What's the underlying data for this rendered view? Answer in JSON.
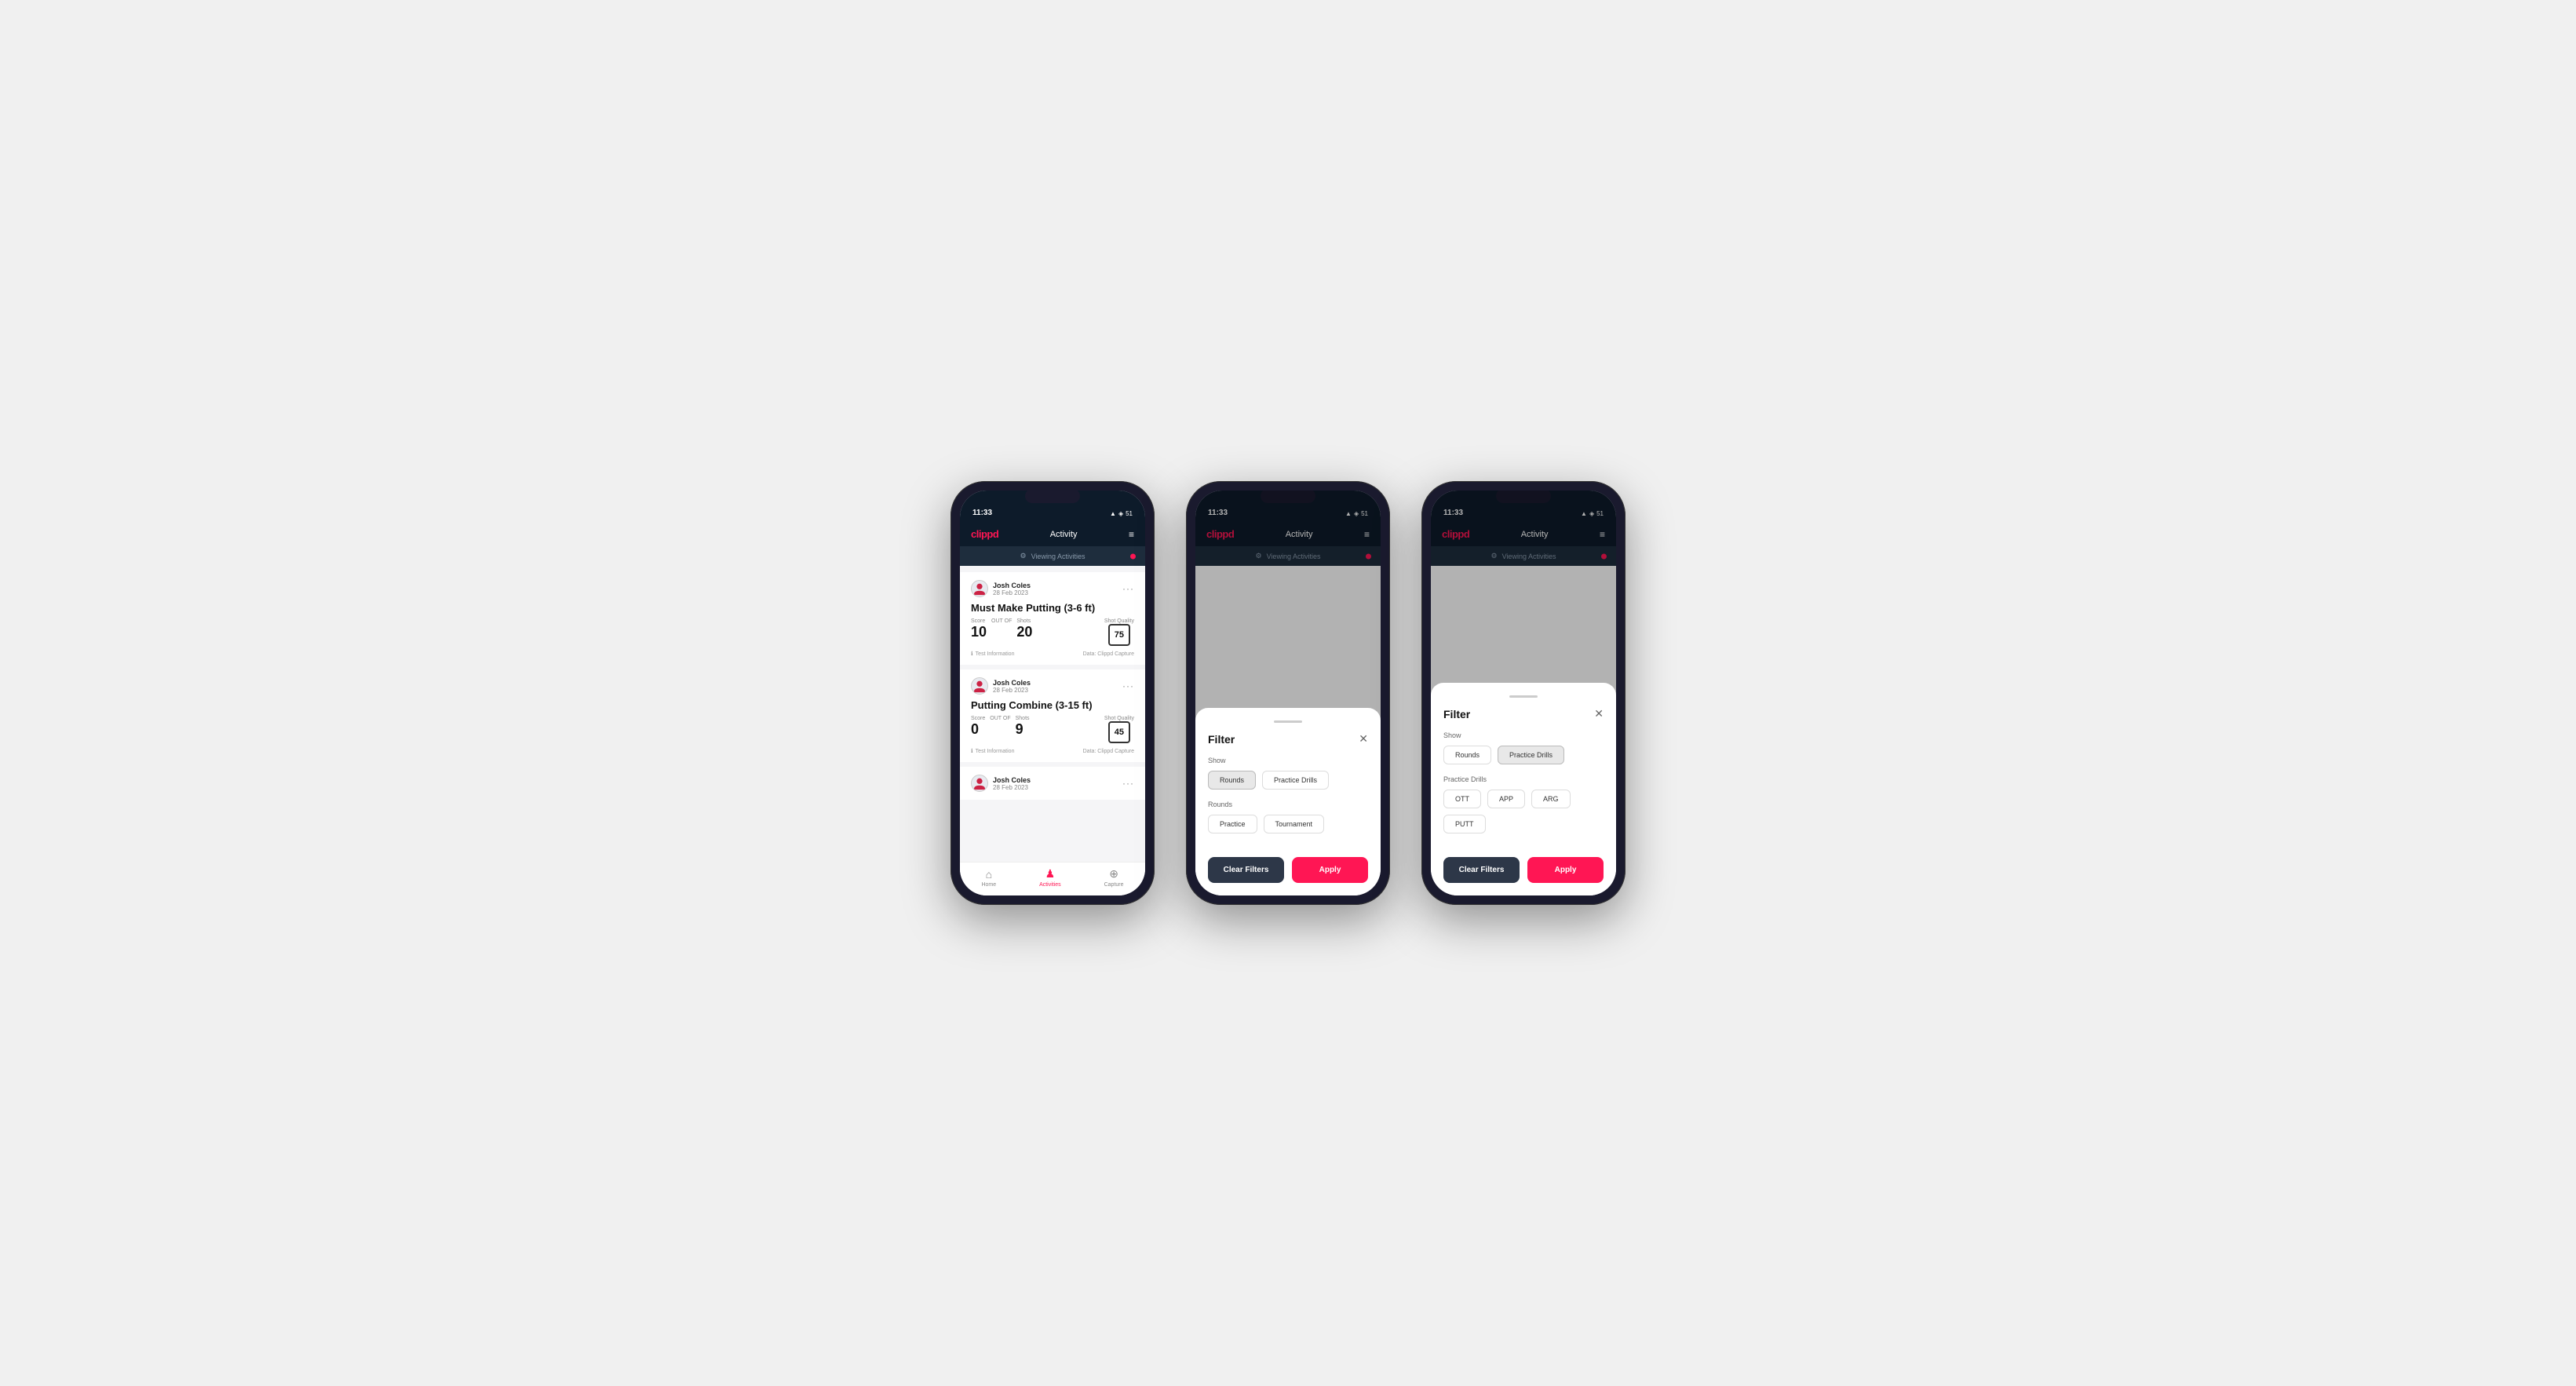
{
  "app": {
    "time": "11:33",
    "logo": "clippd",
    "title": "Activity",
    "banner": "Viewing Activities",
    "statusIcons": "▲ ☰ 51"
  },
  "phone1": {
    "cards": [
      {
        "user": "Josh Coles",
        "date": "28 Feb 2023",
        "title": "Must Make Putting (3-6 ft)",
        "scoreLabel": "Score",
        "score": "10",
        "outOf": "OUT OF",
        "shotsLabel": "Shots",
        "shots": "20",
        "sqLabel": "Shot Quality",
        "sq": "75",
        "testInfo": "Test Information",
        "dataSource": "Data: Clippd Capture"
      },
      {
        "user": "Josh Coles",
        "date": "28 Feb 2023",
        "title": "Putting Combine (3-15 ft)",
        "scoreLabel": "Score",
        "score": "0",
        "outOf": "OUT OF",
        "shotsLabel": "Shots",
        "shots": "9",
        "sqLabel": "Shot Quality",
        "sq": "45",
        "testInfo": "Test Information",
        "dataSource": "Data: Clippd Capture"
      },
      {
        "user": "Josh Coles",
        "date": "28 Feb 2023",
        "title": "",
        "scoreLabel": "",
        "score": "",
        "outOf": "",
        "shotsLabel": "",
        "shots": "",
        "sqLabel": "",
        "sq": "",
        "testInfo": "",
        "dataSource": ""
      }
    ],
    "nav": {
      "home": "Home",
      "activities": "Activities",
      "capture": "Capture"
    }
  },
  "phone2": {
    "filter": {
      "title": "Filter",
      "showLabel": "Show",
      "roundsBtn": "Rounds",
      "practiceDrillsBtn": "Practice Drills",
      "roundsLabel": "Rounds",
      "practiceBtn": "Practice",
      "tournamentBtn": "Tournament",
      "clearFilters": "Clear Filters",
      "apply": "Apply"
    }
  },
  "phone3": {
    "filter": {
      "title": "Filter",
      "showLabel": "Show",
      "roundsBtn": "Rounds",
      "practiceDrillsBtn": "Practice Drills",
      "practiceDrillsLabel": "Practice Drills",
      "ottBtn": "OTT",
      "appBtn": "APP",
      "argBtn": "ARG",
      "puttBtn": "PUTT",
      "clearFilters": "Clear Filters",
      "apply": "Apply"
    }
  }
}
